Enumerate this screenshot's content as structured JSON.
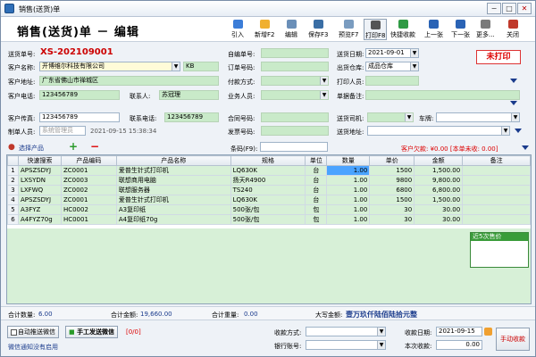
{
  "window": {
    "title": "销售(送货)单",
    "min": "−",
    "max": "□",
    "close": "✕"
  },
  "header": {
    "form_title": "销售(送货)单 － 编辑"
  },
  "toolbar": [
    {
      "label": "引入",
      "icon": "import-icon",
      "color": "#3b7dd8"
    },
    {
      "label": "新增F2",
      "icon": "new-icon",
      "color": "#f0b030"
    },
    {
      "label": "编辑",
      "icon": "edit-icon",
      "color": "#6a8fb8"
    },
    {
      "label": "保存F3",
      "icon": "save-icon",
      "color": "#3a6ea5"
    },
    {
      "label": "预览F7",
      "icon": "preview-icon",
      "color": "#7a9cc0"
    },
    {
      "label": "打印F8",
      "icon": "print-icon",
      "color": "#555"
    },
    {
      "label": "快捷收款",
      "icon": "payment-icon",
      "color": "#2f9a44"
    },
    {
      "label": "上一张",
      "icon": "prev-icon",
      "color": "#2a63b5"
    },
    {
      "label": "下一张",
      "icon": "next-icon",
      "color": "#2a63b5"
    },
    {
      "label": "更多...",
      "icon": "more-icon",
      "color": "#7a7a7a"
    },
    {
      "label": "关闭",
      "icon": "close-icon",
      "color": "#c0392b"
    }
  ],
  "form": {
    "doc_no_label": "送货单号:",
    "doc_no": "XS-202109001",
    "customer_label": "客户名称:",
    "customer": "开博维尔科技有限公司",
    "customer_code": "KB",
    "address_label": "客户地址:",
    "address": "广东省佛山市禅城区",
    "phone_label": "客户电话:",
    "phone": "123456789",
    "contact_label": "联系人:",
    "contact": "苏冠理",
    "fax_label": "客户传真:",
    "fax": "123456789",
    "contact_phone_label": "联系电话:",
    "contact_phone": "123456789",
    "maker_label": "制单人员:",
    "maker_placeholder": "系统管理员",
    "maker_time": "2021-09-15 15:38:34",
    "custom_no_label": "自编单号:",
    "order_no_label": "订单号码:",
    "pay_method_label": "付款方式:",
    "salesman_label": "业务人员:",
    "contract_label": "合同号码:",
    "invoice_label": "发票号码:",
    "date_label": "送货日期:",
    "date": "2021-09-01",
    "warehouse_label": "出货仓库:",
    "warehouse": "成品仓库",
    "printer_label": "打印人员:",
    "remark_label": "单据备注:",
    "driver_label": "送货司机:",
    "plate_label": "车牌:",
    "ship_addr_label": "送货地址:",
    "unprinted": "未打印"
  },
  "grid_bar": {
    "select_product": "选择产品",
    "add": "+",
    "remove": "−",
    "barcode_label": "条码(F9):",
    "arrears": "客户欠款: ¥0.00 [本单未收: 0.00]"
  },
  "grid": {
    "headers": [
      "",
      "快速搜索",
      "产品编码",
      "产品名称",
      "规格",
      "单位",
      "数量",
      "单价",
      "金额",
      "备注"
    ],
    "rows": [
      [
        "1",
        "APSZSDYJ",
        "ZC0001",
        "爱普生针式打印机",
        "LQ630K",
        "台",
        "1.00",
        "1500",
        "1,500.00",
        ""
      ],
      [
        "2",
        "LXSYDN",
        "ZC0003",
        "联想商用电脑",
        "扬天R4900",
        "台",
        "1.00",
        "9800",
        "9,800.00",
        ""
      ],
      [
        "3",
        "LXFWQ",
        "ZC0002",
        "联想服务器",
        "TS240",
        "台",
        "1.00",
        "6800",
        "6,800.00",
        ""
      ],
      [
        "4",
        "APSZSDYJ",
        "ZC0001",
        "爱普生针式打印机",
        "LQ630K",
        "台",
        "1.00",
        "1500",
        "1,500.00",
        ""
      ],
      [
        "5",
        "A3FYZ",
        "HC0002",
        "A3复印纸",
        "500张/包",
        "包",
        "1.00",
        "30",
        "30.00",
        ""
      ],
      [
        "6",
        "A4FYZ70g",
        "HC0001",
        "A4复印纸70g",
        "500张/包",
        "包",
        "1.00",
        "30",
        "30.00",
        ""
      ]
    ],
    "float_title": "近5次售价"
  },
  "totals": {
    "qty_label": "合计数量:",
    "qty": "6.00",
    "amount_label": "合计金额:",
    "amount": "19,660.00",
    "weight_label": "合计重量:",
    "weight": "0.00",
    "capital_label": "大写金额:",
    "capital": "壹万玖仟陆佰陆拾元整"
  },
  "footer": {
    "auto_wechat": "自动推送微信",
    "manual_wechat": "手工发送微信",
    "counter": "[0/0]",
    "wechat_notice": "微信通知没有启用",
    "pay_method_label": "收款方式:",
    "bank_label": "银行账号:",
    "pay_date_label": "收款日期:",
    "pay_date": "2021-09-15",
    "this_pay_label": "本次收款:",
    "this_pay": "0.00",
    "manual_receive": "手动收款"
  }
}
